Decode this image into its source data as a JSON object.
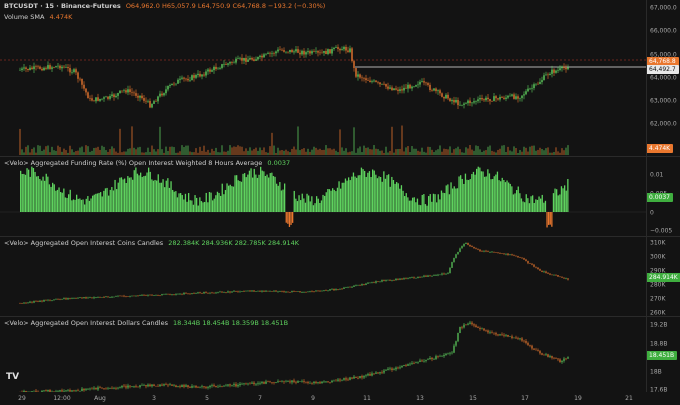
{
  "header": {
    "symbol": "BTCUSDT · 15 · Binance-Futures",
    "ohlc": "O64,962.0 H65,057.9 L64,750.9 C64,768.8 −193.2 (−0.30%)",
    "volume_label": "Volume SMA",
    "volume_value": "4.474K"
  },
  "price_axis": [
    "67,000.0",
    "66,000.0",
    "65,000.0",
    "64,000.0",
    "63,000.0",
    "62,000.0"
  ],
  "price_tags": {
    "last": "64,768.8",
    "line": "64,492.7",
    "volume": "4.474K"
  },
  "funding": {
    "label": "<Velo> Aggregated Funding Rate (%) Open Interest Weighted 8 Hours Average",
    "value": "0.0037",
    "axis": [
      "0.01",
      "0.005",
      "0",
      "−0.005"
    ],
    "tag": "0.0037"
  },
  "oi_coins": {
    "label": "<Velo> Aggregated Open Interest Coins Candles",
    "values": "282.384K 284.936K 282.785K 284.914K",
    "axis": [
      "310K",
      "300K",
      "290K",
      "280K",
      "270K",
      "260K"
    ],
    "tag": "284.914K"
  },
  "oi_dollars": {
    "label": "<Velo> Aggregated Open Interest Dollars Candles",
    "values": "18.344B 18.454B 18.359B 18.451B",
    "axis": [
      "19.2B",
      "18.8B",
      "18B",
      "17.6B"
    ],
    "tag": "18.451B"
  },
  "x_axis": [
    "29",
    "12:00",
    "Aug",
    "3",
    "5",
    "7",
    "9",
    "11",
    "13",
    "15",
    "17",
    "19",
    "21"
  ],
  "colors": {
    "up": "#5fd35f",
    "down": "#e9772e",
    "bg": "#131313"
  },
  "logo": "TV"
}
